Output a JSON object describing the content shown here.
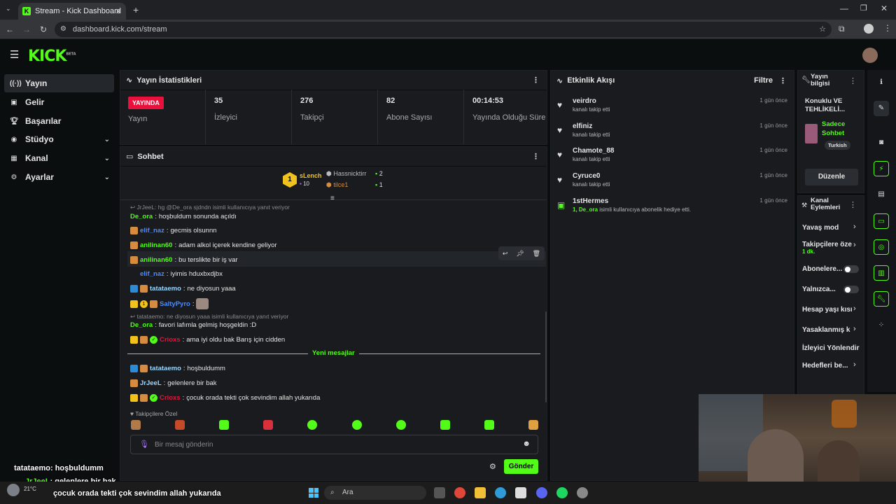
{
  "browser": {
    "tab_title": "Stream - Kick Dashboard",
    "url": "dashboard.kick.com/stream"
  },
  "header": {
    "logo": "KICK",
    "logo_tag": "BETA"
  },
  "sidebar": {
    "items": [
      {
        "label": "Yayın",
        "icon": "broadcast-icon"
      },
      {
        "label": "Gelir",
        "icon": "money-icon"
      },
      {
        "label": "Başarılar",
        "icon": "trophy-icon"
      },
      {
        "label": "Stüdyo",
        "icon": "studio-icon"
      },
      {
        "label": "Kanal",
        "icon": "channel-icon"
      },
      {
        "label": "Ayarlar",
        "icon": "gear-icon"
      }
    ]
  },
  "stats": {
    "title": "Yayın İstatistikleri",
    "status_badge": "YAYINDA",
    "status_label": "Yayın",
    "viewers": "35",
    "viewers_label": "İzleyici",
    "followers": "276",
    "followers_label": "Takipçi",
    "subs": "82",
    "subs_label": "Abone Sayısı",
    "uptime": "00:14:53",
    "uptime_label": "Yayında Olduğu Süre"
  },
  "chat": {
    "title": "Sohbet",
    "leaderboard": {
      "rank": "1",
      "first_user": "sLench",
      "first_count": "10",
      "second_user": "Hassnicktirr",
      "second_count": "2",
      "third_user": "tilce1",
      "third_count": "1"
    },
    "reply1": "JrJeeL: hg @De_ora sjdndn isimli kullanıcıya yanıt veriyor",
    "messages": [
      {
        "user": "De_ora",
        "text": "hoşbuldum sonunda açıldı",
        "color": "#53fc18"
      },
      {
        "user": "elif_naz",
        "text": "gecmis olsunnn",
        "color": "#4d8cff"
      },
      {
        "user": "anilinan60",
        "text": "adam alkol içerek kendine geliyor",
        "color": "#53fc18"
      },
      {
        "user": "anilinan60",
        "text": "bu terslikte bir iş var",
        "color": "#53fc18"
      },
      {
        "user": "elif_naz",
        "text": "iyimis hduxbxdjbx",
        "color": "#4d8cff"
      },
      {
        "user": "tatataemo",
        "text": "ne diyosun yaaa",
        "color": "#9ad8ff"
      },
      {
        "user": "SaltyPyro",
        "text": "",
        "color": "#4d8cff"
      },
      {
        "user": "De_ora",
        "text": "favori lafımla gelmiş hoşgeldin :D",
        "color": "#53fc18"
      },
      {
        "user": "Crioxs",
        "text": "ama iyi oldu bak Barış için cidden",
        "color": "#e9113c"
      }
    ],
    "reply2": "tatataemo: ne diyosun yaaa isimli kullanıcıya yanıt veriyor",
    "new_messages_label": "Yeni mesajlar",
    "new_messages": [
      {
        "user": "tatataemo",
        "text": "hoşbuldumm",
        "color": "#9ad8ff"
      },
      {
        "user": "JrJeeL",
        "text": "gelenlere bir bak",
        "color": "#9ad8ff"
      },
      {
        "user": "Crioxs",
        "text": "çocuk orada tekti çok sevindim allah yukarıda",
        "color": "#e9113c"
      }
    ],
    "emote_section_label": "Takipçilere Özel",
    "input_placeholder": "Bir mesaj gönderin",
    "send_label": "Gönder"
  },
  "events": {
    "title": "Etkinlik Akışı",
    "filter_label": "Filtre",
    "items": [
      {
        "name": "veirdro",
        "desc": "kanalı takip etti",
        "time": "1 gün önce"
      },
      {
        "name": "elfiniz",
        "desc": "kanalı takip etti",
        "time": "1 gün önce"
      },
      {
        "name": "Chamote_88",
        "desc": "kanalı takip etti",
        "time": "1 gün önce"
      },
      {
        "name": "Cyruce0",
        "desc": "kanalı takip etti",
        "time": "1 gün önce"
      },
      {
        "name": "1stHermes",
        "desc_user": "1, De_ora",
        "desc": "isimli kullanıcıya abonelik hediye etti.",
        "time": "1 gün önce"
      }
    ]
  },
  "stream_info": {
    "title": "Yayın bilgisi",
    "stream_title": "Konuklu VE TEHLİKELİ...",
    "category": "Sadece Sohbet",
    "language": "Turkish",
    "edit_label": "Düzenle"
  },
  "channel_actions": {
    "title": "Kanal Eylemleri",
    "items": [
      {
        "label": "Yavaş mod",
        "type": "chevron"
      },
      {
        "label": "Takipçilere öze",
        "sub": "1 dk.",
        "type": "chevron"
      },
      {
        "label": "Abonelere...",
        "type": "toggle"
      },
      {
        "label": "Yalnızca...",
        "type": "toggle"
      },
      {
        "label": "Hesap yaşı kısı",
        "type": "chevron"
      },
      {
        "label": "Yasaklanmış k",
        "type": "chevron"
      },
      {
        "label": "İzleyici Yönlendir",
        "type": "none"
      },
      {
        "label": "Hedefleri be...",
        "type": "chevron"
      }
    ]
  },
  "overlay": {
    "line1_user": "tatataemo",
    "line1_text": "hoşbuldumm",
    "line2_user": "JrJeeL",
    "line2_text": "gelenlere bir bak",
    "line3_text": "çocuk orada tekti çok sevindim allah yukarıda",
    "weather": "21°C"
  },
  "taskbar": {
    "search_placeholder": "Ara"
  }
}
